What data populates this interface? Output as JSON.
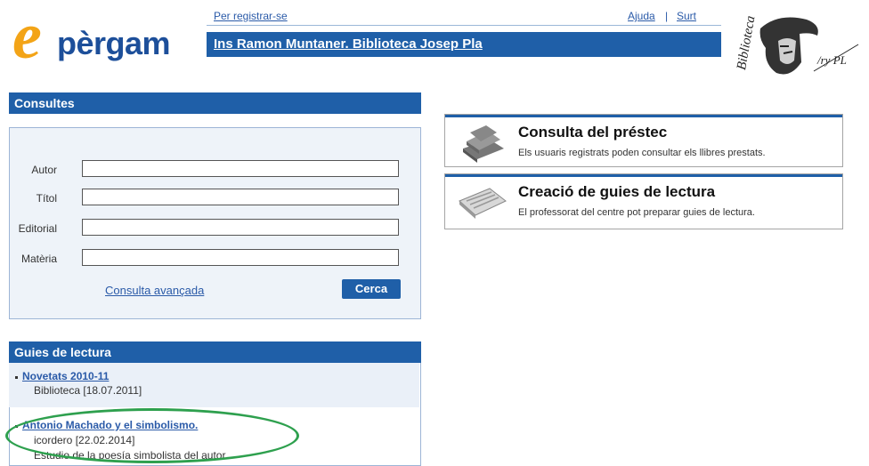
{
  "header": {
    "logo_letter": "e",
    "logo_rest": "pèrgam",
    "register_link": "Per registrar-se",
    "help_link": "Ajuda",
    "separator": "|",
    "exit_link": "Surt",
    "library_name": "Ins Ramon Muntaner. Biblioteca Josep Pla",
    "portrait_text_biblioteca": "Biblioteca",
    "portrait_signature": "/ry PL"
  },
  "consultes": {
    "title": "Consultes",
    "fields": [
      {
        "label": "Autor",
        "value": ""
      },
      {
        "label": "Títol",
        "value": ""
      },
      {
        "label": "Editorial",
        "value": ""
      },
      {
        "label": "Matèria",
        "value": ""
      }
    ],
    "advanced_link": "Consulta avançada",
    "search_button": "Cerca"
  },
  "guies": {
    "title": "Guies de lectura",
    "items": [
      {
        "title": "Novetats 2010-11",
        "sub": "Biblioteca [18.07.2011]"
      },
      {
        "title": "Antonio Machado y el simbolismo.",
        "sub": "icordero [22.02.2014]",
        "desc": "Estudio de la poesía simbolista del autor"
      }
    ]
  },
  "cards": [
    {
      "title": "Consulta del préstec",
      "desc": "Els usuaris registrats poden consultar els llibres prestats.",
      "icon": "books-icon"
    },
    {
      "title": "Creació de guies de lectura",
      "desc": "El professorat del centre pot preparar guies de lectura.",
      "icon": "notepad-icon"
    }
  ],
  "colors": {
    "brand_blue": "#1f5fa8",
    "logo_orange": "#f3a417",
    "highlight_green": "#2ea04e"
  }
}
